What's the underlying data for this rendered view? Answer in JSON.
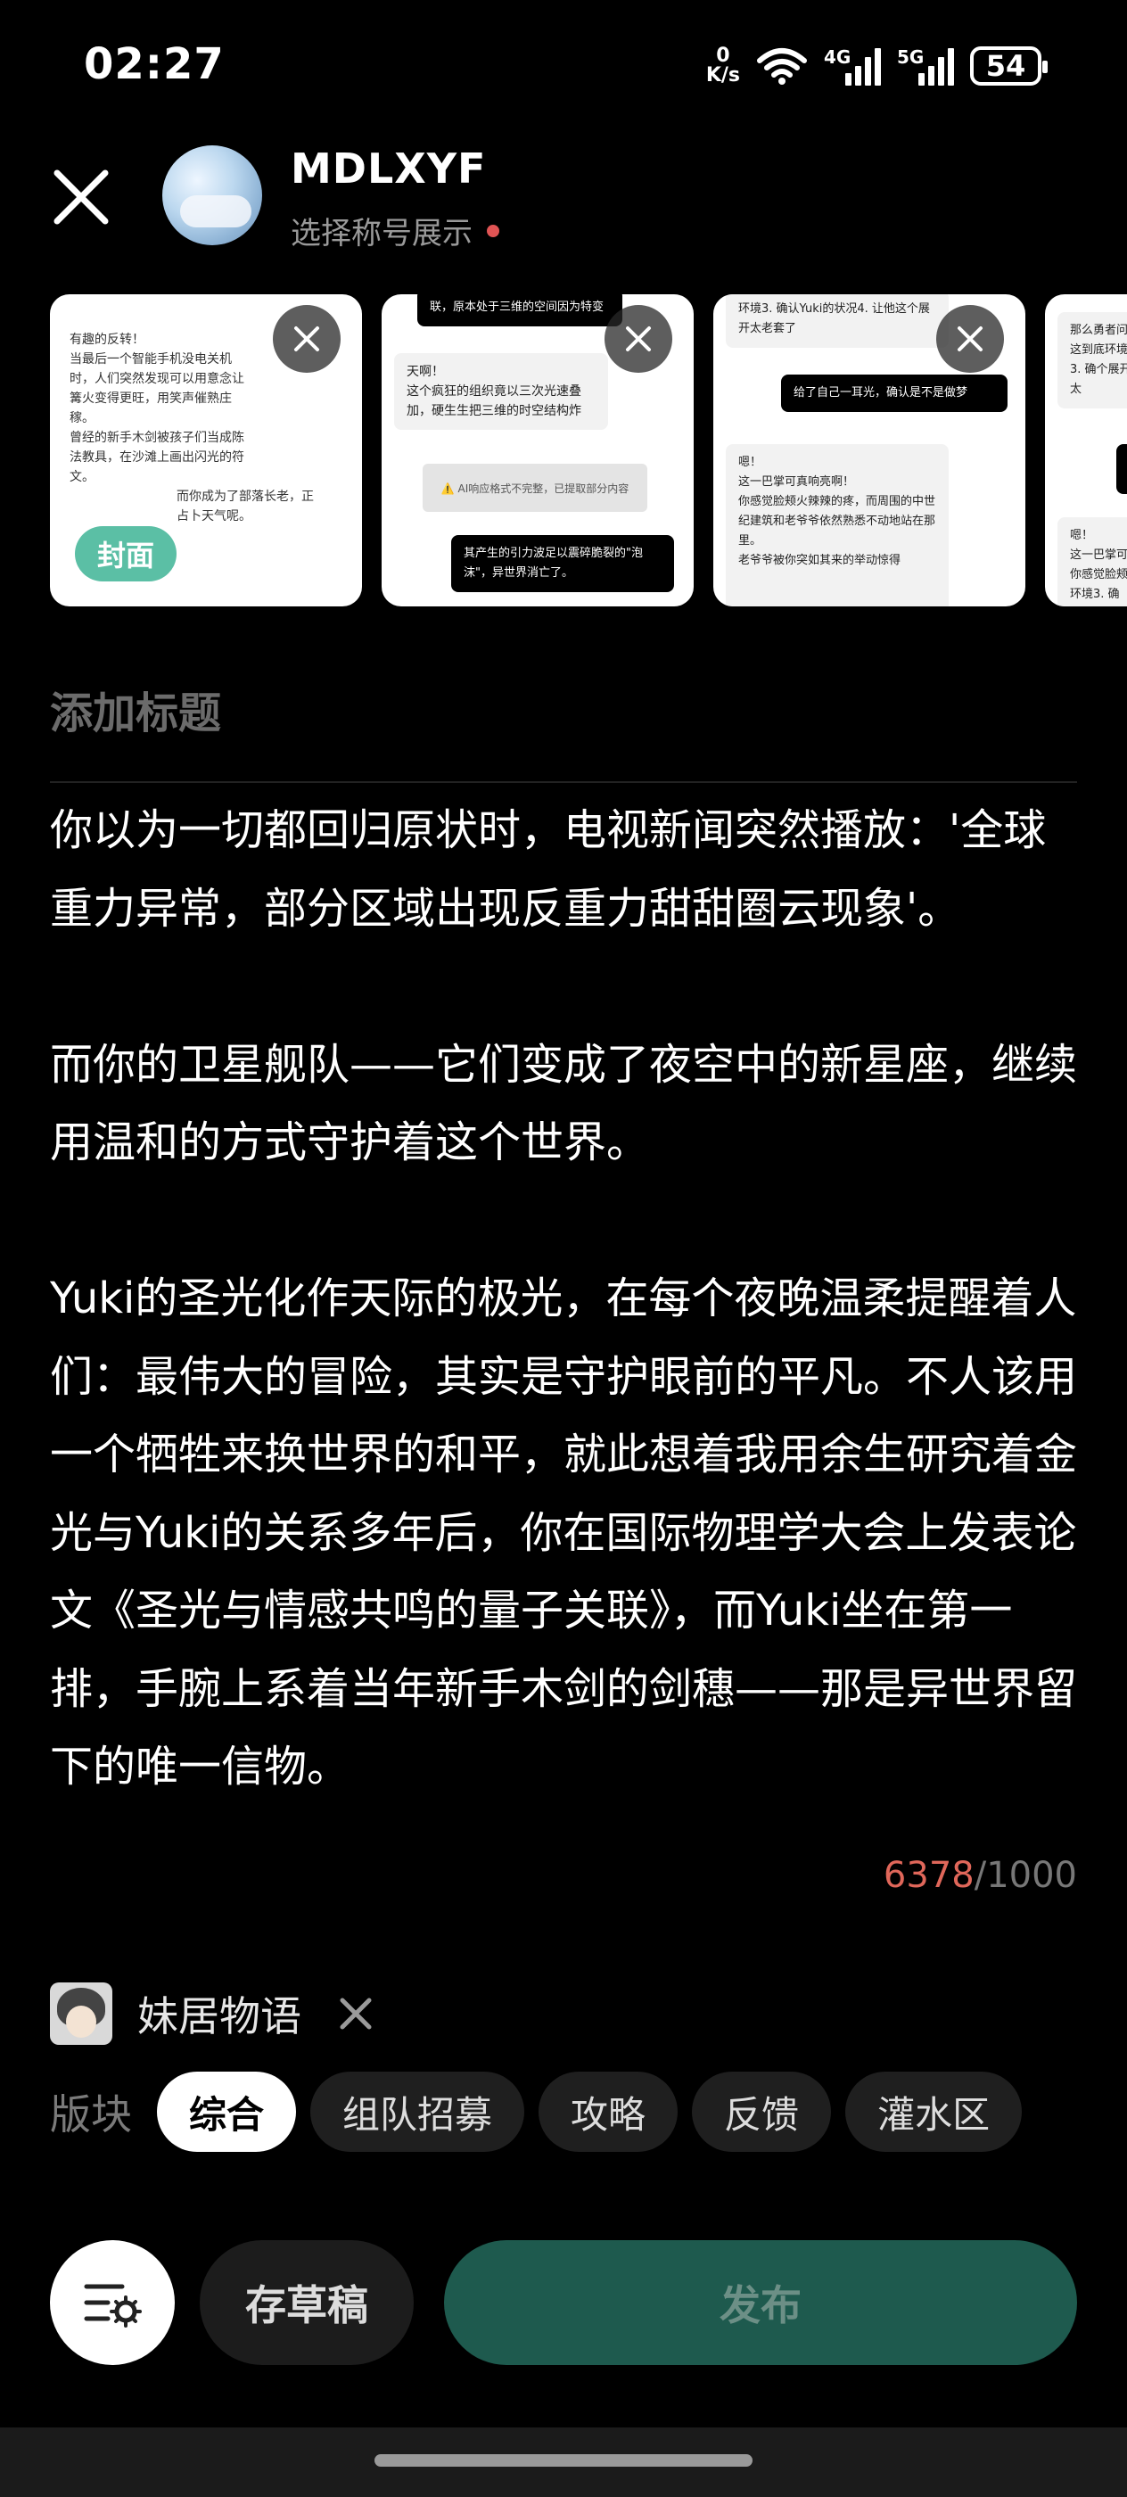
{
  "status_bar": {
    "time": "02:27",
    "net_speed_value": "0",
    "net_speed_unit": "K/s",
    "signal1_label": "4G",
    "signal2_label": "5G",
    "battery": "54"
  },
  "header": {
    "username": "MDLXYF",
    "title_select": "选择称号展示"
  },
  "thumbnails": [
    {
      "lines": [
        "有趣的反转！",
        "当最后一个智能手机没电关机",
        "时，人们突然发现可以用意念让",
        "篝火变得更旺，用笑声催熟庄",
        "稼。",
        "曾经的新手木剑被孩子们当成陈",
        "法教具，在沙滩上画出闪光的符",
        "文。",
        "而你成为了部落长老，正",
        "占卜天气呢。"
      ],
      "cover_label": "封面"
    },
    {
      "top_bubble": "联，原本处于三维的空间因为特变",
      "white_bubble": "天啊！\n这个疯狂的组织竟以三次光速叠加，硬生生把三维的时空结构炸",
      "notice": "⚠️ AI响应格式不完整，已提取部分内容",
      "black_bubble": "其产生的引力波足以震碎脆裂的\"泡沫\"，异世界消亡了。"
    },
    {
      "top_bubble": "环境3. 确认Yuki的状况4. 让他这个展开太老套了",
      "black_bubble": "给了自己一耳光，确认是不是做梦",
      "white_bubble": "嗯！\n这一巴掌可真响亮啊！\n你感觉脸颊火辣辣的疼，而周围的中世纪建筑和老爷爷依然熟悉不动地站在那里。\n老爷爷被你突如其来的举动惊得"
    },
    {
      "top_bubble": "那么勇者问这到底环境3. 确个展开太",
      "white_bubble": "嗯！\n这一巴掌可你感觉脸颊环境3. 确"
    }
  ],
  "editor": {
    "title_placeholder": "添加标题",
    "body": "你以为一切都回归原状时，电视新闻突然播放：'全球重力异常，部分区域出现反重力甜甜圈云现象'。\n\n而你的卫星舰队——它们变成了夜空中的新星座，继续用温和的方式守护着这个世界。\n\nYuki的圣光化作天际的极光，在每个夜晚温柔提醒着人们：最伟大的冒险，其实是守护眼前的平凡。不人该用一个牺牲来换世界的和平，就此想着我用余生研究着金光与Yuki的关系多年后，你在国际物理学大会上发表论文《圣光与情感共鸣的量子关联》，而Yuki坐在第一排，手腕上系着当年新手木剑的剑穗——那是异世界留下的唯一信物。",
    "char_count": "6378",
    "char_limit": "/1000"
  },
  "circle": {
    "name": "妹居物语"
  },
  "sections": {
    "label": "版块",
    "items": [
      "综合",
      "组队招募",
      "攻略",
      "反馈",
      "灌水区"
    ],
    "active_index": 0
  },
  "actions": {
    "draft": "存草稿",
    "publish": "发布"
  },
  "colors": {
    "accent": "#5bbfa5",
    "publish_bg": "#1e5a4e",
    "counter_over": "#e0675a",
    "status_dot": "#e05454"
  }
}
